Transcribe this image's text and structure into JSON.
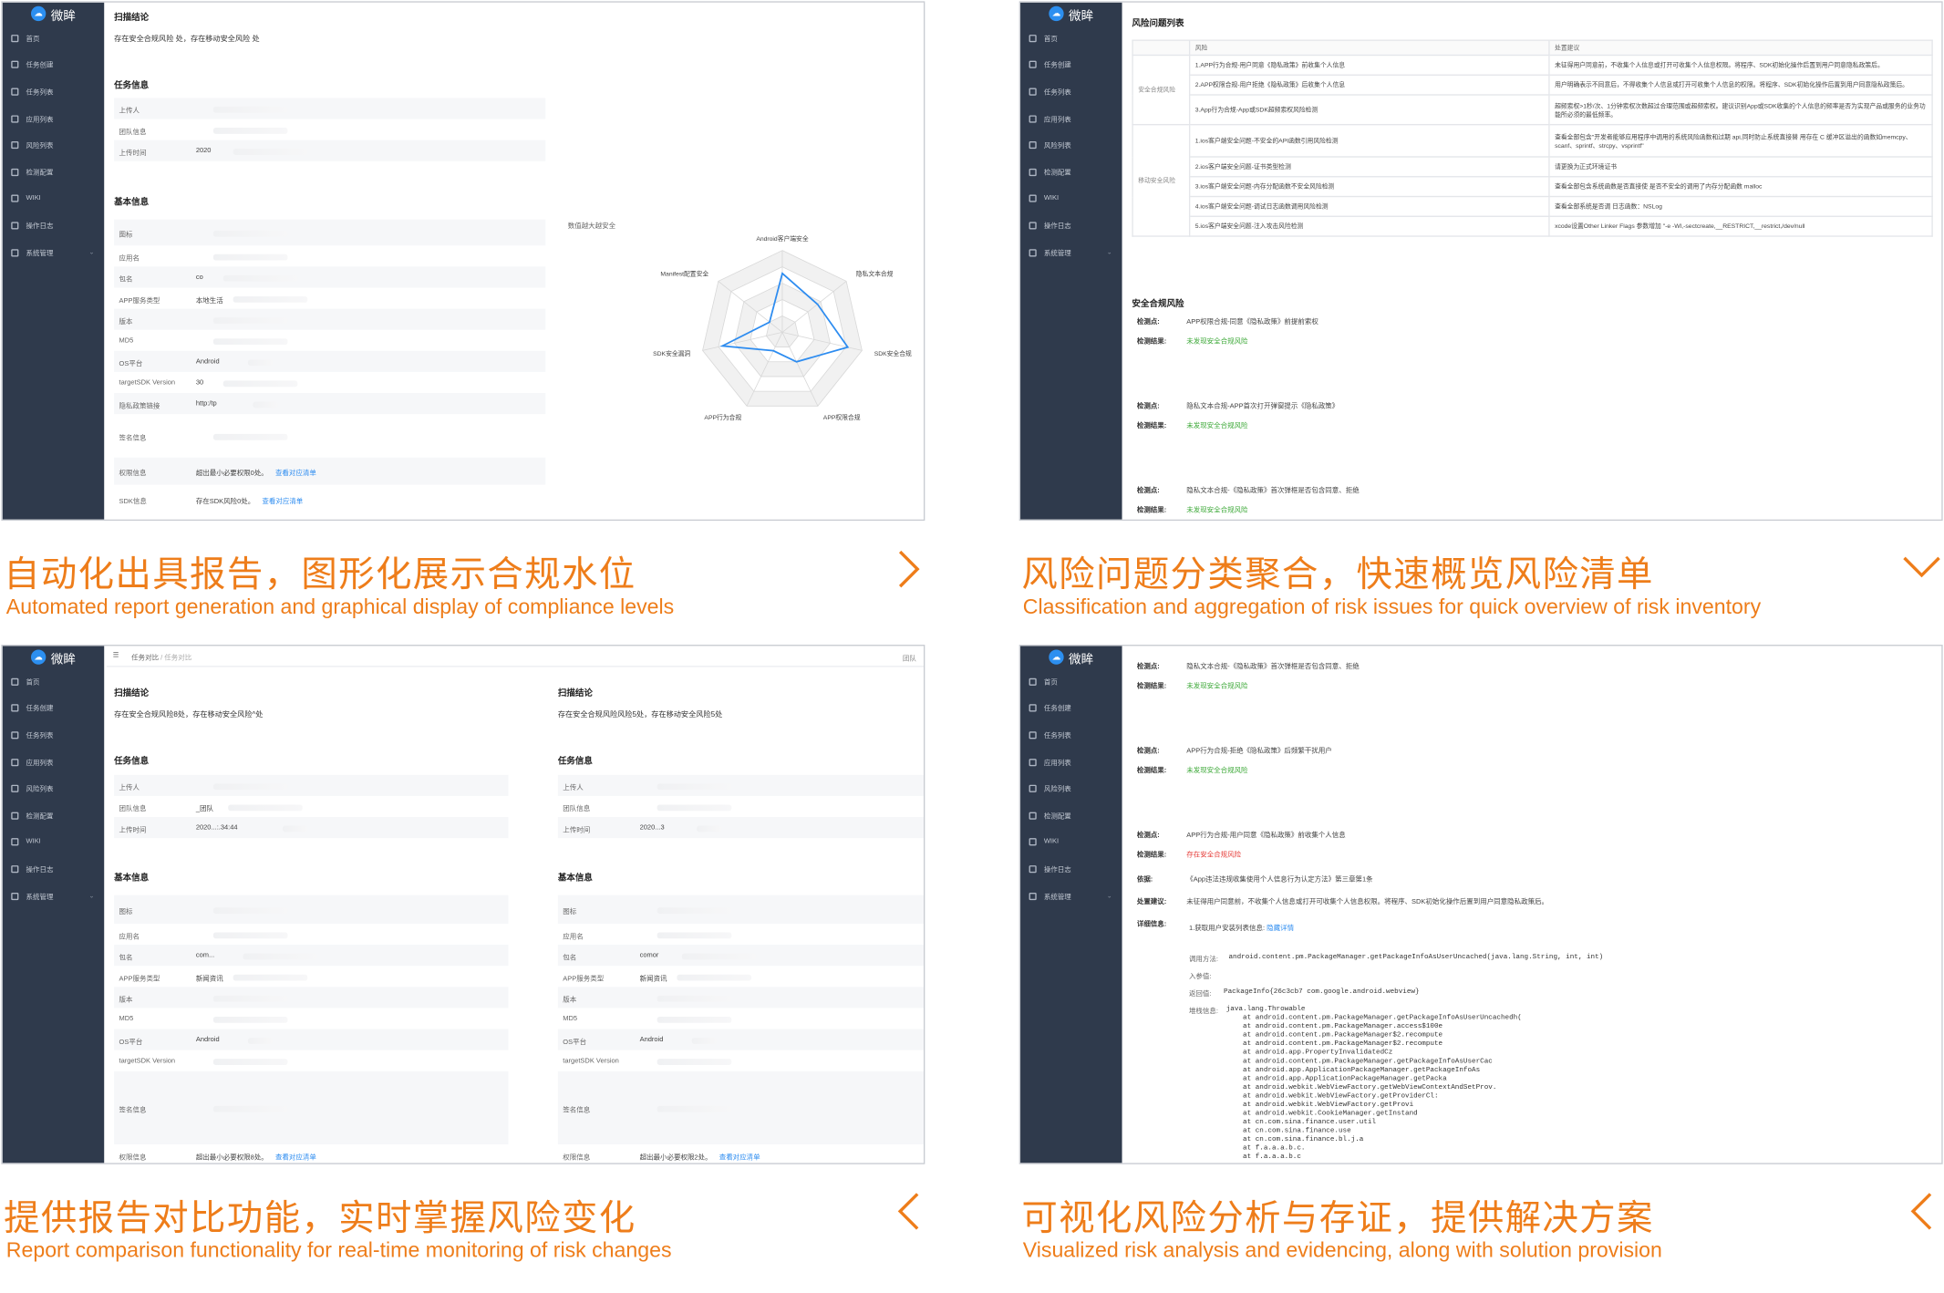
{
  "app_name": "微眸",
  "sidebar": {
    "items": [
      {
        "label": "首页",
        "icon": "home-icon"
      },
      {
        "label": "任务创建",
        "icon": "edit-icon"
      },
      {
        "label": "任务列表",
        "icon": "list-icon"
      },
      {
        "label": "应用列表",
        "icon": "app-icon"
      },
      {
        "label": "风险列表",
        "icon": "risk-icon"
      },
      {
        "label": "检测配置",
        "icon": "config-icon"
      },
      {
        "label": "WIKI",
        "icon": "book-icon"
      },
      {
        "label": "操作日志",
        "icon": "log-icon"
      },
      {
        "label": "系统管理",
        "icon": "user-icon"
      }
    ]
  },
  "panel1": {
    "scan_title": "扫描结论",
    "scan_text": "存在安全合规风险   处，存在移动安全风险   处",
    "task_title": "任务信息",
    "task_rows": [
      {
        "label": "上传人",
        "value": ""
      },
      {
        "label": "团队信息",
        "value": ""
      },
      {
        "label": "上传时间",
        "value": "2020"
      }
    ],
    "basic_title": "基本信息",
    "basic_rows": [
      {
        "label": "图标",
        "value": ""
      },
      {
        "label": "应用名",
        "value": ""
      },
      {
        "label": "包名",
        "value": "co"
      },
      {
        "label": "APP服务类型",
        "value": "本地生活"
      },
      {
        "label": "版本",
        "value": ""
      },
      {
        "label": "MD5",
        "value": ""
      },
      {
        "label": "OS平台",
        "value": "Android"
      },
      {
        "label": "targetSDK Version",
        "value": "30"
      },
      {
        "label": "隐私政策链接",
        "value": "http:/tp"
      },
      {
        "label": "签名信息",
        "value": ""
      },
      {
        "label": "权限信息",
        "value": "超出最小必要权限0处。",
        "link": "查看对应清单"
      },
      {
        "label": "SDK信息",
        "value": "存在SDK风险0处。",
        "link": "查看对应清单"
      }
    ],
    "radar": {
      "title": "数值越大越安全",
      "axes": [
        "Android客户端安全",
        "隐私文本合规",
        "SDK安全合规",
        "APP权限合规",
        "APP行为合规",
        "SDK安全漏洞",
        "Manifest配置安全"
      ],
      "values": [
        0.72,
        0.55,
        0.82,
        0.4,
        0.25,
        0.75,
        0.2
      ]
    }
  },
  "panel2": {
    "title": "风险问题列表",
    "col_risk": "风险",
    "col_advice": "处置建议",
    "groups": [
      {
        "name": "安全合规风险",
        "rows": [
          {
            "risk": "1.APP行为合规-用户同意《隐私政策》前收集个人信息",
            "advice": "未征得用户同意前，不收集个人信息或打开可收集个人信息权限。将程序、SDK初始化操作后置到用户同意隐私政策后。"
          },
          {
            "risk": "2.APP权限合规-用户拒绝《隐私政策》后收集个人信息",
            "advice": "用户明确表示不同意后，不得收集个人信息或打开可收集个人信息的权限。将程序、SDK初始化操作后置到用户同意隐私政策后。"
          },
          {
            "risk": "3.App行为合规-App或SDK超频索权风险检测",
            "advice": "超频索权>1秒/次、1分钟索权次数超过合理范围或超频索权。建议识别App或SDK收集的个人信息的频率是否为实现产品或服务的业务功能所必须的最低频率。"
          }
        ]
      },
      {
        "name": "移动安全风险",
        "rows": [
          {
            "risk": "1.ios客户端安全问题-不安全的API函数引用风险检测",
            "advice": "查看全部包含\"开发者能够应用程序中调用的系统风险函数和过期 api,同时防止系统直接替 用存在 C 缓冲区溢出的函数如memcpy、scanf、sprintf、strcpy、vsprintf\""
          },
          {
            "risk": "2.ios客户端安全问题-证书类型检测",
            "advice": "请更换为正式环境证书"
          },
          {
            "risk": "3.ios客户端安全问题-内存分配函数不安全风险检测",
            "advice": "查看全部包含系统函数是否直接使 是否不安全的调用了内存分配函数 malloc"
          },
          {
            "risk": "4.ios客户端安全问题-调试日志函数调用风险检测",
            "advice": "查看全部系统是否调 日志函数：NSLog"
          },
          {
            "risk": "5.ios客户端安全问题-注入攻击风险检测",
            "advice": "xcode设置Other Linker Flags 参数增加 \"-e -Wl,-sectcreate,__RESTRICT,__restrict,/dev/null"
          }
        ]
      }
    ],
    "compliance_title": "安全合规风险",
    "checks": [
      {
        "point_label": "检测点:",
        "point": "APP权限合规-同意《隐私政策》前提前索权",
        "result_label": "检测结果:",
        "result": "未发现安全合规风险"
      },
      {
        "point_label": "检测点:",
        "point": "隐私文本合规-APP首次打开弹窗提示《隐私政策》",
        "result_label": "检测结果:",
        "result": "未发现安全合规风险"
      },
      {
        "point_label": "检测点:",
        "point": "隐私文本合规-《隐私政策》首次弹框是否包含同意、拒绝",
        "result_label": "检测结果:",
        "result": "未发现安全合规风险"
      }
    ]
  },
  "panel3": {
    "breadcrumb_root": "任务对比",
    "breadcrumb_sep": "/",
    "breadcrumb_current": "任务对比",
    "team": "团队",
    "left": {
      "scan_title": "扫描结论",
      "scan_text": "存在安全合规风险8处，存在移动安全风险^处",
      "task_title": "任务信息",
      "task_rows": [
        {
          "label": "上传人",
          "value": ""
        },
        {
          "label": "团队信息",
          "value": "_团队"
        },
        {
          "label": "上传时间",
          "value": "2020...:.34:44"
        }
      ],
      "basic_title": "基本信息",
      "basic_rows": [
        {
          "label": "图标",
          "value": ""
        },
        {
          "label": "应用名",
          "value": ""
        },
        {
          "label": "包名",
          "value": "com..."
        },
        {
          "label": "APP服务类型",
          "value": "新闻资讯"
        },
        {
          "label": "版本",
          "value": ""
        },
        {
          "label": "MD5",
          "value": ""
        },
        {
          "label": "OS平台",
          "value": "Android"
        },
        {
          "label": "targetSDK Version",
          "value": ""
        },
        {
          "label": "签名信息",
          "value": ""
        },
        {
          "label": "权限信息",
          "value": "超出最小必要权限8处。",
          "link": "查看对应清单"
        }
      ]
    },
    "right": {
      "scan_title": "扫描结论",
      "scan_text": "存在安全合规风险风险5处，存在移动安全风险5处",
      "task_title": "任务信息",
      "task_rows": [
        {
          "label": "上传人",
          "value": ""
        },
        {
          "label": "团队信息",
          "value": ""
        },
        {
          "label": "上传时间",
          "value": "2020...3"
        }
      ],
      "basic_title": "基本信息",
      "basic_rows": [
        {
          "label": "图标",
          "value": ""
        },
        {
          "label": "应用名",
          "value": ""
        },
        {
          "label": "包名",
          "value": "comor"
        },
        {
          "label": "APP服务类型",
          "value": "新闻资讯"
        },
        {
          "label": "版本",
          "value": ""
        },
        {
          "label": "MD5",
          "value": ""
        },
        {
          "label": "OS平台",
          "value": "Android"
        },
        {
          "label": "targetSDK Version",
          "value": ""
        },
        {
          "label": "签名信息",
          "value": ""
        },
        {
          "label": "权限信息",
          "value": "超出最小必要权限2处。",
          "link": "查看对应清单"
        }
      ]
    }
  },
  "panel4": {
    "checks": [
      {
        "point_label": "检测点:",
        "point": "隐私文本合规-《隐私政策》首次弹框是否包含同意、拒绝",
        "result_label": "检测结果:",
        "result": "未发现安全合规风险",
        "status": "ok"
      },
      {
        "point_label": "检测点:",
        "point": "APP行为合规-拒绝《隐私政策》后频繁干扰用户",
        "result_label": "检测结果:",
        "result": "未发现安全合规风险",
        "status": "ok"
      },
      {
        "point_label": "检测点:",
        "point": "APP行为合规-用户同意《隐私政策》前收集个人信息",
        "result_label": "检测结果:",
        "result": "存在安全合规风险",
        "status": "risk"
      }
    ],
    "basis_label": "依据:",
    "basis": "《App违法违规收集使用个人信息行为认定方法》第三章第1条",
    "advice_label": "处置建议:",
    "advice": "未征得用户同意前，不收集个人信息或打开可收集个人信息权限。将程序、SDK初始化操作后置到用户同意隐私政策后。",
    "detail_label": "详细信息:",
    "detail_item": "1.获取用户安装列表信息:",
    "detail_link": "隐藏详情",
    "call_label": "调用方法:",
    "call": "android.content.pm.PackageManager.getPackageInfoAsUserUncached(java.lang.String, int, int)",
    "param_label": "入参值:",
    "return_label": "返回值:",
    "return_value": "PackageInfo{26c3cb7 com.google.android.webview}",
    "stack_label": "堆栈信息:",
    "stack": [
      "java.lang.Throwable",
      "    at android.content.pm.PackageManager.getPackageInfoAsUserUncachedh(",
      "    at android.content.pm.PackageManager.access$100e",
      "    at android.content.pm.PackageManager$2.recompute",
      "    at android.content.pm.PackageManager$2.recompute",
      "    at android.app.PropertyInvalidatedCz",
      "    at android.content.pm.PackageManager.getPackageInfoAsUserCac",
      "    at android.app.ApplicationPackageManager.getPackageInfoAs",
      "    at android.app.ApplicationPackageManager.getPacka",
      "    at android.webkit.WebViewFactory.getWebViewContextAndSetProv.",
      "    at android.webkit.WebViewFactory.getProviderCl:",
      "    at android.webkit.WebViewFactory.getProvi",
      "    at android.webkit.CookieManager.getInstand",
      "    at cn.com.sina.finance.user.util",
      "    at cn.com.sina.finance.use",
      "    at cn.com.sina.finance.bl.j.a",
      "    at f.a.a.a.b.c.",
      "    at f.a.a.a.b.c"
    ]
  },
  "captions": [
    {
      "cn": "自动化出具报告，图形化展示合规水位",
      "en": "Automated report generation and graphical display of compliance levels"
    },
    {
      "cn": "风险问题分类聚合，快速概览风险清单",
      "en": "Classification and aggregation of risk issues for quick overview of risk inventory"
    },
    {
      "cn": "提供报告对比功能，实时掌握风险变化",
      "en": "Report comparison functionality for real-time monitoring of risk changes"
    },
    {
      "cn": "可视化风险分析与存证，提供解决方案",
      "en": "Visualized risk analysis and evidencing, along with solution provision"
    }
  ],
  "colors": {
    "accent": "#ee7d1a",
    "sidebar": "#2f3a4c",
    "link": "#2d8cf0",
    "ok": "#39a734",
    "risk": "#e53935",
    "radar": "#2d8cf0"
  }
}
